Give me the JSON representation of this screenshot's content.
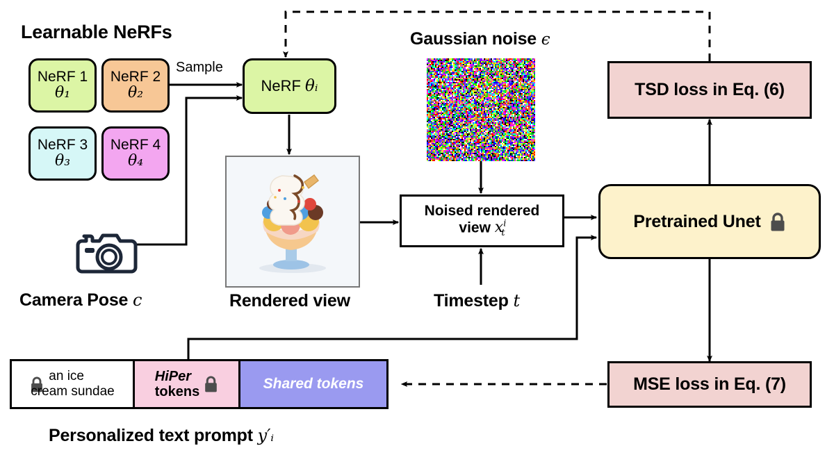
{
  "diagram": {
    "title_learnable_nerfs": "Learnable NeRFs",
    "nerfs": [
      {
        "name": "NeRF 1",
        "theta": "θ₁",
        "color": "#dcf5a5"
      },
      {
        "name": "NeRF 2",
        "theta": "θ₂",
        "color": "#f7c796"
      },
      {
        "name": "NeRF 3",
        "theta": "θ₃",
        "color": "#d6f7f7"
      },
      {
        "name": "NeRF 4",
        "theta": "θ₄",
        "color": "#f3a6f0"
      }
    ],
    "sample_label": "Sample",
    "nerf_selected": {
      "label": "NeRF",
      "theta": "θᵢ",
      "color": "#dcf5a5"
    },
    "camera_pose_label": "Camera Pose",
    "camera_pose_symbol": "c",
    "camera_icon": "camera-icon",
    "rendered_view_label": "Rendered view",
    "rendered_view_alt": "an ice cream sundae",
    "gaussian_noise_label": "Gaussian noise",
    "gaussian_noise_symbol": "ϵ",
    "noised_box_line1": "Noised rendered",
    "noised_box_line2": "view",
    "noised_box_symbol": "x",
    "noised_box_sup": "i",
    "noised_box_sub": "t",
    "timestep_label": "Timestep",
    "timestep_symbol": "t",
    "tsd_loss_label": "TSD loss in Eq. (6)",
    "tsd_loss_color": "#f2d3d1",
    "unet_label": "Pretrained Unet",
    "unet_color": "#fdf2cb",
    "unet_lock": "lock-icon",
    "mse_loss_label": "MSE loss in Eq. (7)",
    "mse_loss_color": "#f2d3d1",
    "prompt": {
      "caption": "Personalized text prompt",
      "caption_symbol": "y′ᵢ",
      "text_cell_line1": "an ice",
      "text_cell_line2": "cream sundae",
      "text_cell_lock": "lock-icon",
      "text_cell_color": "#ffffff",
      "hiper_cell_line1": "HiPer",
      "hiper_cell_line2": "tokens",
      "hiper_cell_lock": "lock-icon",
      "hiper_cell_color": "#f9cfe0",
      "shared_cell_label": "Shared tokens",
      "shared_cell_color": "#9a9af0"
    }
  }
}
